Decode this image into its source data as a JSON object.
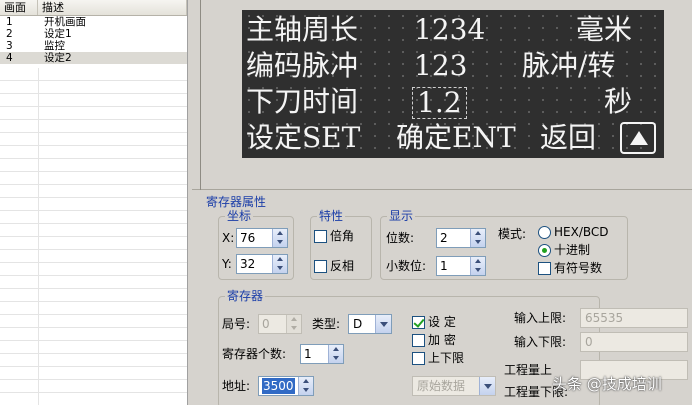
{
  "screen_list": {
    "headers": [
      "画面",
      "描述"
    ],
    "rows": [
      {
        "num": "1",
        "desc": "开机画面"
      },
      {
        "num": "2",
        "desc": "设定1"
      },
      {
        "num": "3",
        "desc": "监控"
      },
      {
        "num": "4",
        "desc": "设定2"
      }
    ]
  },
  "lcd": {
    "row1": {
      "label": "主轴周长",
      "value": "1234",
      "unit": "毫米"
    },
    "row2": {
      "label": "编码脉冲",
      "value": "123",
      "unit": "脉冲/转"
    },
    "row3": {
      "label": "下刀时间",
      "value": "1.2",
      "unit": "秒"
    },
    "row4": {
      "set": "设定SET",
      "ent": "确定ENT",
      "back": "返回"
    }
  },
  "props": {
    "title": "寄存器属性",
    "coord": {
      "title": "坐标",
      "x_label": "X:",
      "x_value": "76",
      "y_label": "Y:",
      "y_value": "32"
    },
    "attr": {
      "title": "特性",
      "double": "倍角",
      "invert": "反相"
    },
    "display": {
      "title": "显示",
      "digits_label": "位数:",
      "digits_value": "2",
      "decimals_label": "小数位:",
      "decimals_value": "1"
    },
    "mode": {
      "label": "模式:",
      "hex": "HEX/BCD",
      "decimal": "十进制",
      "signed": "有符号数"
    },
    "register": {
      "title": "寄存器",
      "station_label": "局号:",
      "station_value": "0",
      "type_label": "类型:",
      "type_value": "D",
      "count_label": "寄存器个数:",
      "count_value": "1",
      "addr_label": "地址:",
      "addr_value": "3500",
      "setting": "设  定",
      "encrypt": "加  密",
      "limits": "上下限",
      "raw_data": "原始数据",
      "upper_label": "输入上限:",
      "upper_value": "65535",
      "lower_label": "输入下限:",
      "lower_value": "0",
      "eng_upper_label": "工程量上",
      "eng_lower_label": "工程量下限:"
    }
  },
  "watermark": "头条 @技成培训"
}
